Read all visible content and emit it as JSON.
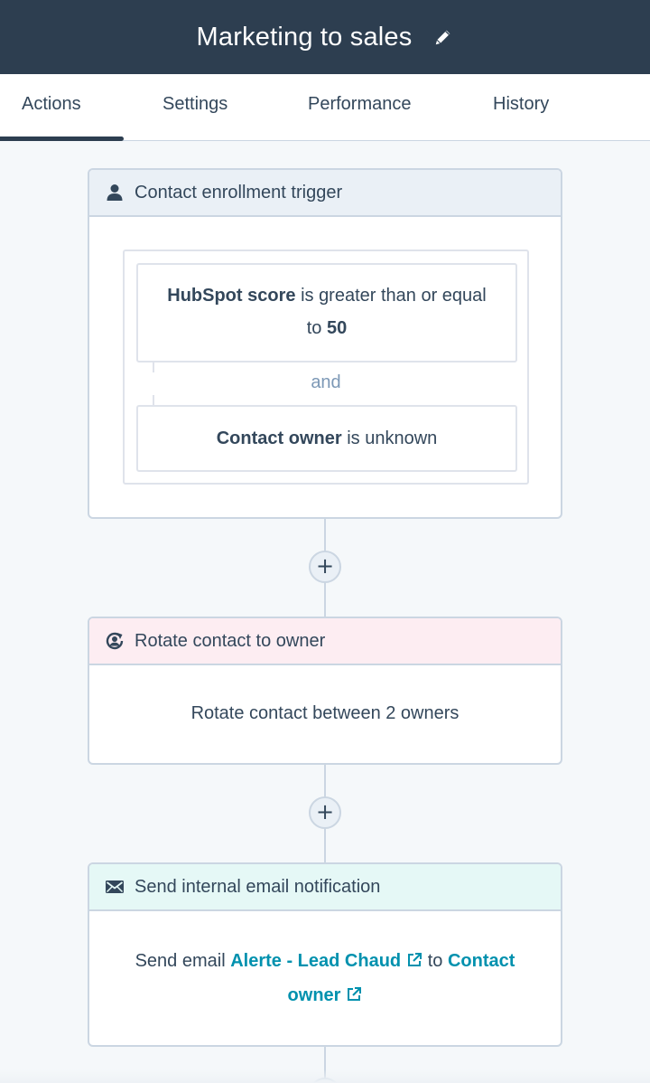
{
  "header": {
    "title": "Marketing to sales",
    "edit_icon": "pencil-icon"
  },
  "tabs": [
    {
      "label": "Actions",
      "active": true
    },
    {
      "label": "Settings",
      "active": false
    },
    {
      "label": "Performance",
      "active": false
    },
    {
      "label": "History",
      "active": false
    }
  ],
  "trigger": {
    "title": "Contact enrollment trigger",
    "icon": "person-icon",
    "condition1": {
      "property": "HubSpot score",
      "operator": "is greater than or equal",
      "connector": "to",
      "value": "50"
    },
    "joiner": "and",
    "condition2": {
      "property": "Contact owner",
      "operator": "is unknown"
    }
  },
  "actions": [
    {
      "title": "Rotate contact to owner",
      "icon": "rotate-owner-icon",
      "description": "Rotate contact between 2 owners"
    },
    {
      "title": "Send internal email notification",
      "icon": "envelope-icon",
      "prefix": "Send email",
      "email_name": "Alerte - Lead Chaud",
      "to_word": "to",
      "recipient_1": "Contact",
      "recipient_2": "owner"
    }
  ],
  "add_button_label": "+",
  "colors": {
    "header_bg": "#2d3e50",
    "trigger_header": "#eaf0f6",
    "rotate_header": "#fdedf2",
    "email_header": "#e5f8f6",
    "link": "#0091ae"
  }
}
